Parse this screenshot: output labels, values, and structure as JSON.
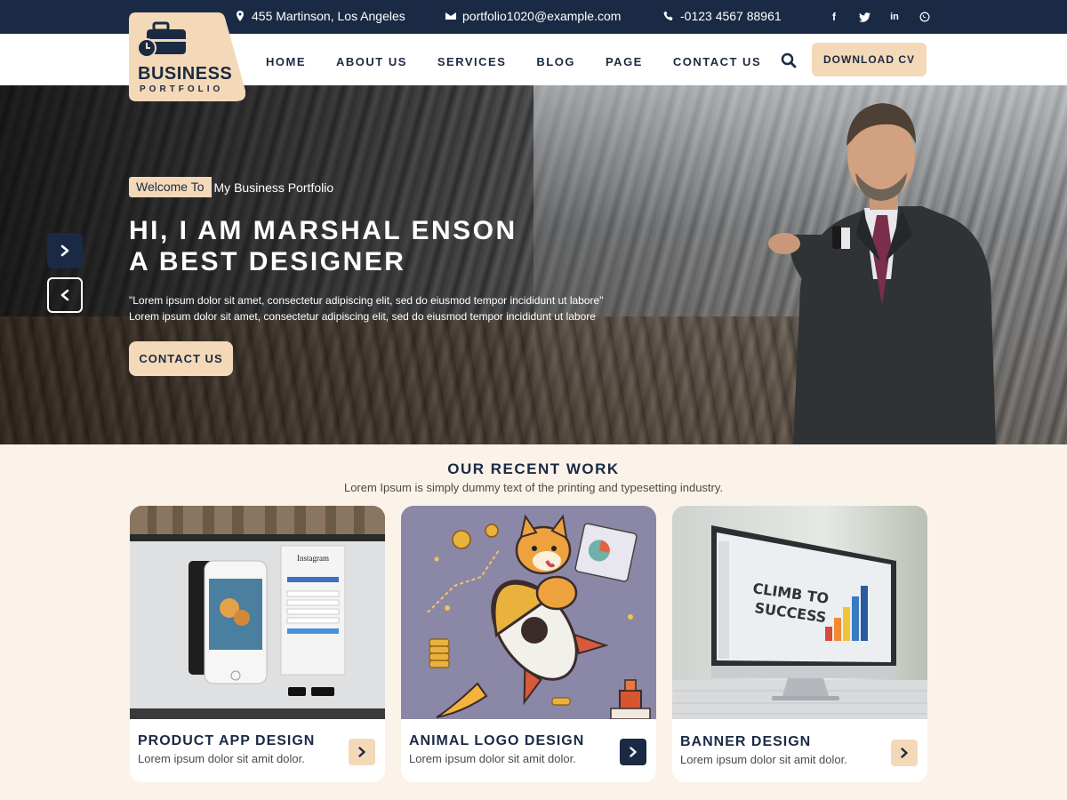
{
  "topbar": {
    "address": "455 Martinson, Los Angeles",
    "email": "portfolio1020@example.com",
    "phone": "-0123 4567 88961",
    "social": [
      "facebook-icon",
      "twitter-icon",
      "linkedin-icon",
      "whatsapp-icon"
    ]
  },
  "logo": {
    "brand": "BUSINESS",
    "sub": "PORTFOLIO"
  },
  "nav": {
    "items": [
      "HOME",
      "ABOUT US",
      "SERVICES",
      "BLOG",
      "PAGE",
      "CONTACT US"
    ],
    "cta": "DOWNLOAD CV"
  },
  "hero": {
    "welcome_tag": "Welcome To",
    "welcome_text": "My Business Portfolio",
    "headline_line1": "HI, I AM MARSHAL ENSON",
    "headline_line2": "A BEST DESIGNER",
    "desc_line1": "\"Lorem ipsum dolor sit amet, consectetur adipiscing elit, sed do eiusmod tempor incididunt ut labore\"",
    "desc_line2": "Lorem ipsum dolor sit amet, consectetur adipiscing elit, sed do eiusmod tempor incididunt ut labore",
    "cta": "CONTACT US"
  },
  "recent_work": {
    "title": "OUR RECENT WORK",
    "subtitle": "Lorem Ipsum is simply dummy text of the printing and typesetting industry.",
    "cards": [
      {
        "title": "PRODUCT APP DESIGN",
        "text": "Lorem ipsum dolor sit amit dolor."
      },
      {
        "title": "ANIMAL LOGO DESIGN",
        "text": "Lorem ipsum dolor sit amit dolor."
      },
      {
        "title": "BANNER DESIGN",
        "text": "Lorem ipsum dolor sit amit dolor."
      }
    ]
  },
  "colors": {
    "navy": "#1b2a44",
    "accent": "#f3d9b8",
    "section_bg": "#fbf3e9"
  }
}
